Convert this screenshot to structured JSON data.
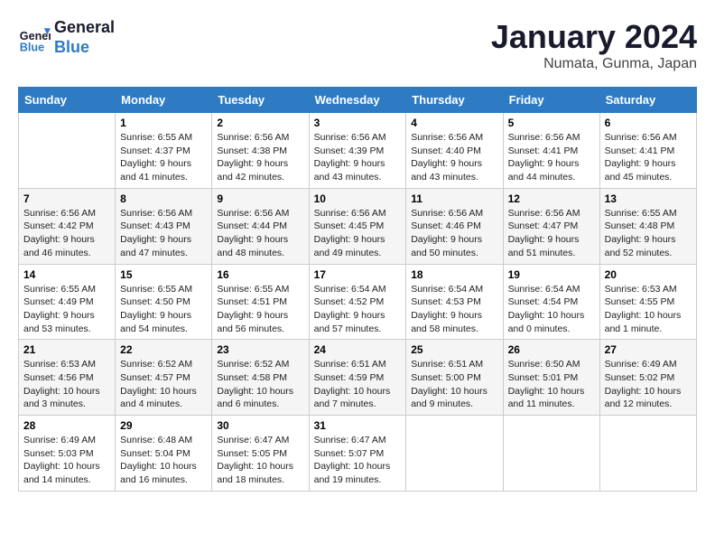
{
  "header": {
    "logo_line1": "General",
    "logo_line2": "Blue",
    "title": "January 2024",
    "subtitle": "Numata, Gunma, Japan"
  },
  "calendar": {
    "days_of_week": [
      "Sunday",
      "Monday",
      "Tuesday",
      "Wednesday",
      "Thursday",
      "Friday",
      "Saturday"
    ],
    "weeks": [
      [
        {
          "day": "",
          "content": ""
        },
        {
          "day": "1",
          "content": "Sunrise: 6:55 AM\nSunset: 4:37 PM\nDaylight: 9 hours\nand 41 minutes."
        },
        {
          "day": "2",
          "content": "Sunrise: 6:56 AM\nSunset: 4:38 PM\nDaylight: 9 hours\nand 42 minutes."
        },
        {
          "day": "3",
          "content": "Sunrise: 6:56 AM\nSunset: 4:39 PM\nDaylight: 9 hours\nand 43 minutes."
        },
        {
          "day": "4",
          "content": "Sunrise: 6:56 AM\nSunset: 4:40 PM\nDaylight: 9 hours\nand 43 minutes."
        },
        {
          "day": "5",
          "content": "Sunrise: 6:56 AM\nSunset: 4:41 PM\nDaylight: 9 hours\nand 44 minutes."
        },
        {
          "day": "6",
          "content": "Sunrise: 6:56 AM\nSunset: 4:41 PM\nDaylight: 9 hours\nand 45 minutes."
        }
      ],
      [
        {
          "day": "7",
          "content": "Sunrise: 6:56 AM\nSunset: 4:42 PM\nDaylight: 9 hours\nand 46 minutes."
        },
        {
          "day": "8",
          "content": "Sunrise: 6:56 AM\nSunset: 4:43 PM\nDaylight: 9 hours\nand 47 minutes."
        },
        {
          "day": "9",
          "content": "Sunrise: 6:56 AM\nSunset: 4:44 PM\nDaylight: 9 hours\nand 48 minutes."
        },
        {
          "day": "10",
          "content": "Sunrise: 6:56 AM\nSunset: 4:45 PM\nDaylight: 9 hours\nand 49 minutes."
        },
        {
          "day": "11",
          "content": "Sunrise: 6:56 AM\nSunset: 4:46 PM\nDaylight: 9 hours\nand 50 minutes."
        },
        {
          "day": "12",
          "content": "Sunrise: 6:56 AM\nSunset: 4:47 PM\nDaylight: 9 hours\nand 51 minutes."
        },
        {
          "day": "13",
          "content": "Sunrise: 6:55 AM\nSunset: 4:48 PM\nDaylight: 9 hours\nand 52 minutes."
        }
      ],
      [
        {
          "day": "14",
          "content": "Sunrise: 6:55 AM\nSunset: 4:49 PM\nDaylight: 9 hours\nand 53 minutes."
        },
        {
          "day": "15",
          "content": "Sunrise: 6:55 AM\nSunset: 4:50 PM\nDaylight: 9 hours\nand 54 minutes."
        },
        {
          "day": "16",
          "content": "Sunrise: 6:55 AM\nSunset: 4:51 PM\nDaylight: 9 hours\nand 56 minutes."
        },
        {
          "day": "17",
          "content": "Sunrise: 6:54 AM\nSunset: 4:52 PM\nDaylight: 9 hours\nand 57 minutes."
        },
        {
          "day": "18",
          "content": "Sunrise: 6:54 AM\nSunset: 4:53 PM\nDaylight: 9 hours\nand 58 minutes."
        },
        {
          "day": "19",
          "content": "Sunrise: 6:54 AM\nSunset: 4:54 PM\nDaylight: 10 hours\nand 0 minutes."
        },
        {
          "day": "20",
          "content": "Sunrise: 6:53 AM\nSunset: 4:55 PM\nDaylight: 10 hours\nand 1 minute."
        }
      ],
      [
        {
          "day": "21",
          "content": "Sunrise: 6:53 AM\nSunset: 4:56 PM\nDaylight: 10 hours\nand 3 minutes."
        },
        {
          "day": "22",
          "content": "Sunrise: 6:52 AM\nSunset: 4:57 PM\nDaylight: 10 hours\nand 4 minutes."
        },
        {
          "day": "23",
          "content": "Sunrise: 6:52 AM\nSunset: 4:58 PM\nDaylight: 10 hours\nand 6 minutes."
        },
        {
          "day": "24",
          "content": "Sunrise: 6:51 AM\nSunset: 4:59 PM\nDaylight: 10 hours\nand 7 minutes."
        },
        {
          "day": "25",
          "content": "Sunrise: 6:51 AM\nSunset: 5:00 PM\nDaylight: 10 hours\nand 9 minutes."
        },
        {
          "day": "26",
          "content": "Sunrise: 6:50 AM\nSunset: 5:01 PM\nDaylight: 10 hours\nand 11 minutes."
        },
        {
          "day": "27",
          "content": "Sunrise: 6:49 AM\nSunset: 5:02 PM\nDaylight: 10 hours\nand 12 minutes."
        }
      ],
      [
        {
          "day": "28",
          "content": "Sunrise: 6:49 AM\nSunset: 5:03 PM\nDaylight: 10 hours\nand 14 minutes."
        },
        {
          "day": "29",
          "content": "Sunrise: 6:48 AM\nSunset: 5:04 PM\nDaylight: 10 hours\nand 16 minutes."
        },
        {
          "day": "30",
          "content": "Sunrise: 6:47 AM\nSunset: 5:05 PM\nDaylight: 10 hours\nand 18 minutes."
        },
        {
          "day": "31",
          "content": "Sunrise: 6:47 AM\nSunset: 5:07 PM\nDaylight: 10 hours\nand 19 minutes."
        },
        {
          "day": "",
          "content": ""
        },
        {
          "day": "",
          "content": ""
        },
        {
          "day": "",
          "content": ""
        }
      ]
    ]
  }
}
